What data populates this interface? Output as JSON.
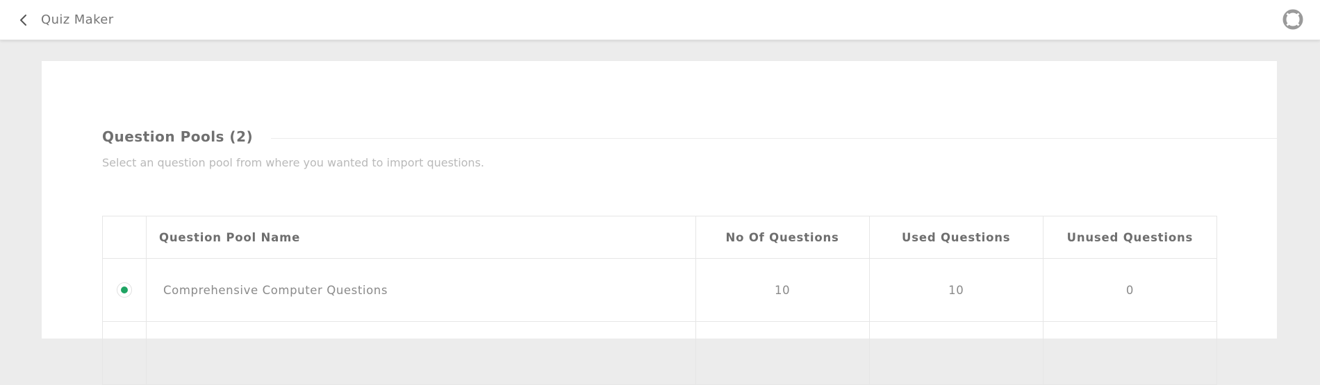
{
  "header": {
    "title": "Quiz Maker",
    "back_icon": "chevron-left-icon",
    "help_icon": "lifebuoy-icon"
  },
  "section": {
    "title": "Question Pools (2)",
    "subtitle": "Select an question pool from where you wanted to import questions."
  },
  "table": {
    "columns": [
      "",
      "Question Pool Name",
      "No Of Questions",
      "Used Questions",
      "Unused Questions"
    ],
    "rows": [
      {
        "selected": true,
        "name": "Comprehensive Computer Questions",
        "no_of_questions": "10",
        "used_questions": "10",
        "unused_questions": "0"
      }
    ]
  },
  "colors": {
    "accent": "#1fa463",
    "background": "#ececec",
    "card": "#ffffff"
  }
}
